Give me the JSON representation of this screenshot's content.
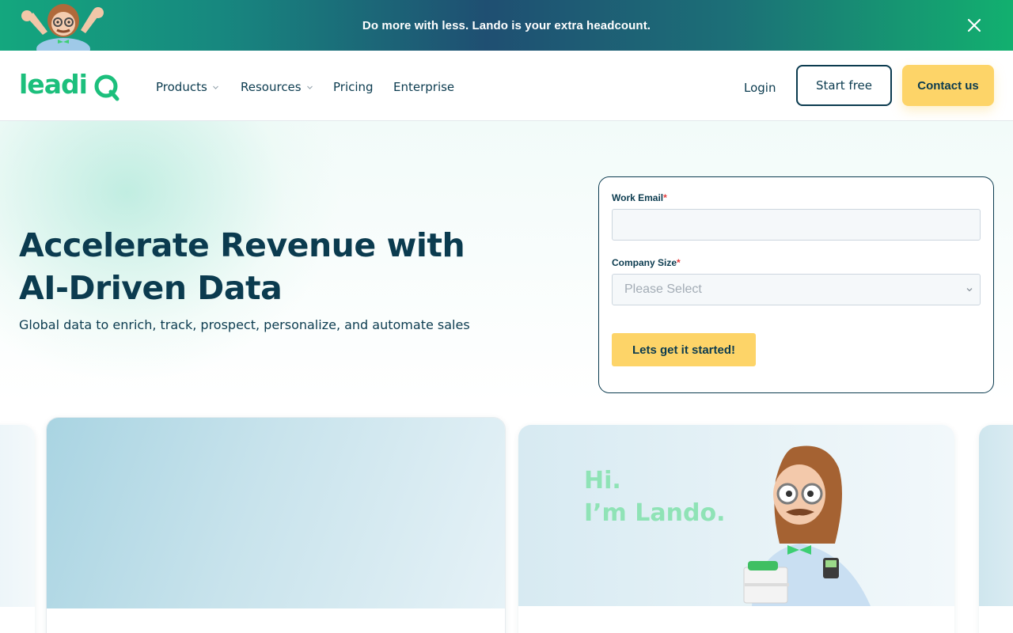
{
  "banner": {
    "text": "Do more with less. Lando is your extra headcount.",
    "close_icon": "close-icon",
    "mascot_icon": "mascot-icon"
  },
  "nav": {
    "logo_text": "leadiQ",
    "items": [
      {
        "label": "Products",
        "has_dropdown": true
      },
      {
        "label": "Resources",
        "has_dropdown": true
      },
      {
        "label": "Pricing",
        "has_dropdown": false
      },
      {
        "label": "Enterprise",
        "has_dropdown": false
      }
    ],
    "login": "Login",
    "start_free": "Start free",
    "contact": "Contact us"
  },
  "hero": {
    "title": "Accelerate Revenue with AI-Driven Data",
    "subtitle": "Global data to enrich, track, prospect, personalize, and automate sales"
  },
  "form": {
    "email_label": "Work Email",
    "company_size_label": "Company Size",
    "required_mark": "*",
    "company_size_placeholder": "Please Select",
    "submit": "Lets get it started!"
  },
  "cards": {
    "lando_greeting_line1": "Hi.",
    "lando_greeting_line2": "I’m Lando."
  },
  "colors": {
    "brand_green": "#1cbf7c",
    "navy": "#0b3b4f",
    "yellow": "#fdd468",
    "required_red": "#e23b3b"
  }
}
